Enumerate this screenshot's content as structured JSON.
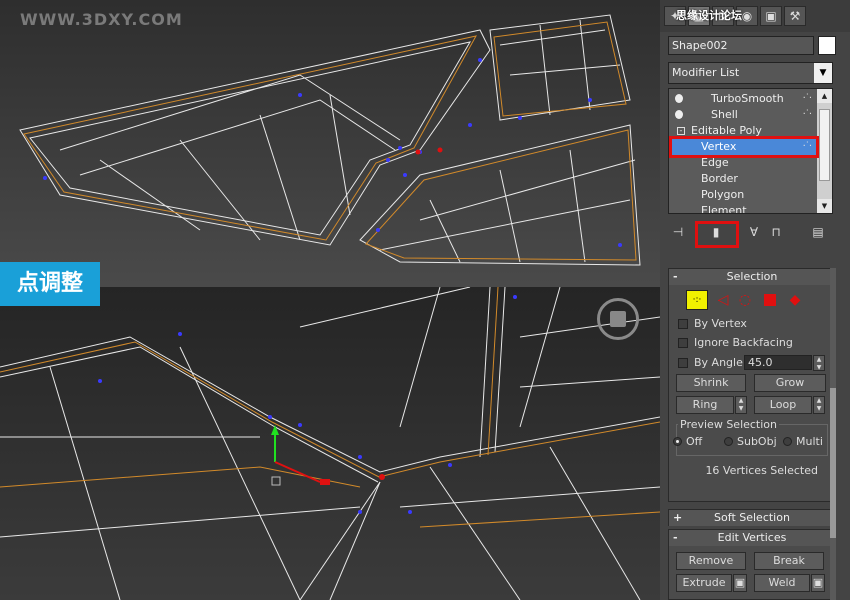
{
  "viewport": {
    "watermark": "WWW.3DXY.COM",
    "step_label": "点调整"
  },
  "panel": {
    "top_watermark": "思缘设计论坛",
    "object_name": "Shape002",
    "object_color": "#ffffff",
    "modifier_list_label": "Modifier List",
    "stack": [
      {
        "label": "TurboSmooth",
        "kind": "modifier",
        "indent": 1
      },
      {
        "label": "Shell",
        "kind": "modifier",
        "indent": 1
      },
      {
        "label": "Editable Poly",
        "kind": "base",
        "indent": 0
      },
      {
        "label": "Vertex",
        "kind": "sub",
        "selected": true
      },
      {
        "label": "Edge",
        "kind": "sub"
      },
      {
        "label": "Border",
        "kind": "sub"
      },
      {
        "label": "Polygon",
        "kind": "sub"
      },
      {
        "label": "Element",
        "kind": "sub"
      }
    ],
    "selection": {
      "title": "Selection",
      "by_vertex": "By Vertex",
      "ignore_backfacing": "Ignore Backfacing",
      "by_angle": "By Angle:",
      "angle_value": "45.0",
      "shrink": "Shrink",
      "grow": "Grow",
      "ring": "Ring",
      "loop": "Loop",
      "preview_title": "Preview Selection",
      "preview_off": "Off",
      "preview_subobj": "SubObj",
      "preview_multi": "Multi",
      "status": "16 Vertices Selected"
    },
    "soft_selection": {
      "title": "Soft Selection"
    },
    "edit_vertices": {
      "title": "Edit Vertices",
      "remove": "Remove",
      "break": "Break",
      "extrude": "Extrude",
      "weld": "Weld"
    },
    "colors": {
      "highlight": "#e01010",
      "selected_row": "#4a88d8",
      "vertex_level": "#ffff00",
      "element_level": "#e01010"
    }
  }
}
